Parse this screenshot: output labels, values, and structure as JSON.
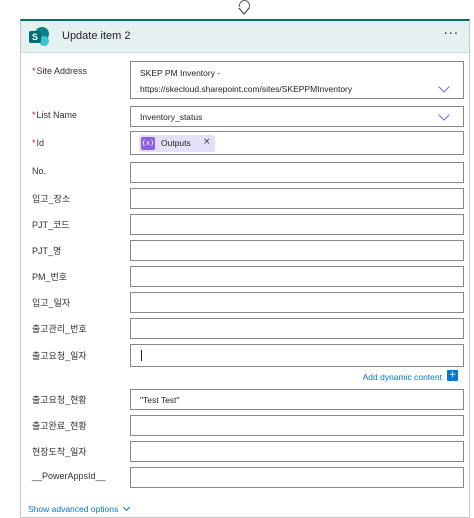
{
  "header": {
    "title": "Update item 2",
    "more": "···",
    "logo_letter": "S"
  },
  "fields": {
    "site_address": {
      "label": "Site Address",
      "line1": "SKEP PM Inventory -",
      "line2": "https://skecloud.sharepoint.com/sites/SKEPPMInventory"
    },
    "list_name": {
      "label": "List Name",
      "value": "Inventory_status"
    },
    "id": {
      "label": "Id",
      "token_icon": "{x}",
      "token": "Outputs",
      "token_close": "×"
    },
    "no": {
      "label": "No.",
      "value": ""
    },
    "f1": {
      "label": "입고_장소",
      "value": ""
    },
    "f2": {
      "label": "PJT_코드",
      "value": ""
    },
    "f3": {
      "label": "PJT_명",
      "value": ""
    },
    "f4": {
      "label": "PM_번호",
      "value": ""
    },
    "f5": {
      "label": "입고_일자",
      "value": ""
    },
    "f6": {
      "label": "출고관리_번호",
      "value": ""
    },
    "f7": {
      "label": "출고요청_일자",
      "value": ""
    },
    "f8": {
      "label": "출고요청_현황",
      "value": "\"Test Test\""
    },
    "f9": {
      "label": "출고완료_현황",
      "value": ""
    },
    "f10": {
      "label": "현장도착_일자",
      "value": ""
    },
    "f11": {
      "label": "__PowerAppsId__",
      "value": ""
    }
  },
  "required_marker": "*",
  "dynamic_content": {
    "label": "Add dynamic content",
    "plus": "+"
  },
  "advanced": {
    "label": "Show advanced options"
  },
  "colors": {
    "accent": "#036c70",
    "link": "#0078d4",
    "token_bg": "#e5e0fa",
    "token_icon": "#8a5ee3",
    "chevron": "#7160e8"
  }
}
